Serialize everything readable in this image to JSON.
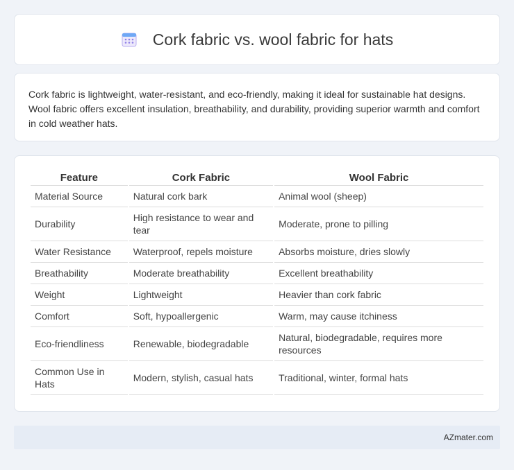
{
  "header": {
    "title": "Cork fabric vs. wool fabric for hats",
    "icon": "calendar-icon",
    "icon_color": "#7b68ee"
  },
  "summary": {
    "text": "Cork fabric is lightweight, water-resistant, and eco-friendly, making it ideal for sustainable hat designs. Wool fabric offers excellent insulation, breathability, and durability, providing superior warmth and comfort in cold weather hats."
  },
  "table": {
    "headers": [
      "Feature",
      "Cork Fabric",
      "Wool Fabric"
    ],
    "rows": [
      [
        "Material Source",
        "Natural cork bark",
        "Animal wool (sheep)"
      ],
      [
        "Durability",
        "High resistance to wear and tear",
        "Moderate, prone to pilling"
      ],
      [
        "Water Resistance",
        "Waterproof, repels moisture",
        "Absorbs moisture, dries slowly"
      ],
      [
        "Breathability",
        "Moderate breathability",
        "Excellent breathability"
      ],
      [
        "Weight",
        "Lightweight",
        "Heavier than cork fabric"
      ],
      [
        "Comfort",
        "Soft, hypoallergenic",
        "Warm, may cause itchiness"
      ],
      [
        "Eco-friendliness",
        "Renewable, biodegradable",
        "Natural, biodegradable, requires more resources"
      ],
      [
        "Common Use in Hats",
        "Modern, stylish, casual hats",
        "Traditional, winter, formal hats"
      ]
    ]
  },
  "footer": {
    "brand": "AZmater.com"
  }
}
